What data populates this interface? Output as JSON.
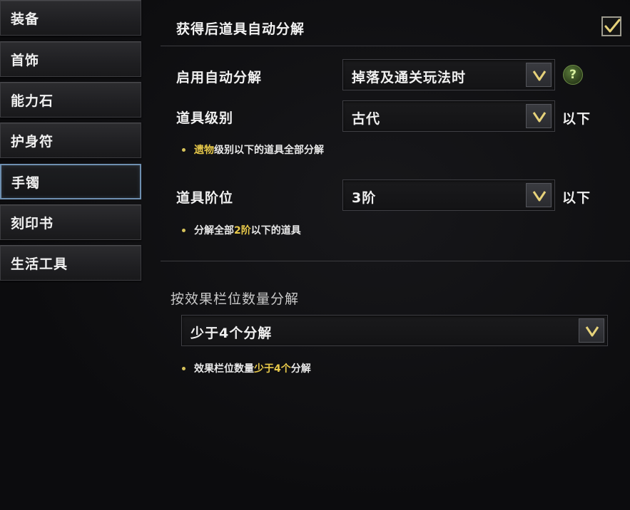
{
  "sidebar": {
    "items": [
      {
        "label": "装备"
      },
      {
        "label": "首饰"
      },
      {
        "label": "能力石"
      },
      {
        "label": "护身符"
      },
      {
        "label": "手镯",
        "active": true
      },
      {
        "label": "刻印书"
      },
      {
        "label": "生活工具"
      }
    ]
  },
  "main": {
    "auto_decompose": {
      "title": "获得后道具自动分解",
      "checked": true
    },
    "enable": {
      "label": "启用自动分解",
      "selected": "掉落及通关玩法时"
    },
    "grade": {
      "label": "道具级别",
      "selected": "古代",
      "suffix": "以下",
      "note_highlight": "遗物",
      "note_rest": "级别以下的道具全部分解"
    },
    "tier": {
      "label": "道具阶位",
      "selected": "3阶",
      "suffix": "以下",
      "note_prefix": "分解全部",
      "note_highlight": "2阶",
      "note_rest": "以下的道具"
    },
    "effect_slots": {
      "title": "按效果栏位数量分解",
      "selected": "少于4个分解",
      "note_prefix": "效果栏位数量",
      "note_highlight": "少于4个",
      "note_rest": "分解"
    }
  },
  "icons": {
    "checkbox": "check-icon",
    "dropdown": "chevron-down-icon",
    "help": "question-mark-icon"
  },
  "colors": {
    "accent_gold": "#e8c94a",
    "active_border": "#6e8fb0",
    "help_green": "#5a7a3a"
  }
}
